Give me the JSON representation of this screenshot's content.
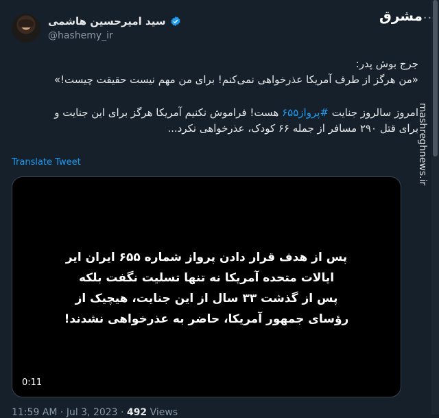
{
  "author": {
    "name": "سید امیرحسین هاشمی",
    "handle": "@hashemy_ir"
  },
  "tweet": {
    "line1": "جرج بوش پدر:",
    "line2": "«من هرگز از طرف آمریکا عذرخواهی نمی‌کنم! برای من مهم نیست حقیقت چیست!»",
    "line3_before": "امروز سالروز جنایت ",
    "hashtag": "#پرواز۶۵۵",
    "line3_after": " هست! فراموش نکنیم آمریکا هرگز برای این جنایت و",
    "line4": "برای قتل ۲۹۰ مسافر از جمله ۶۶ کودک، عذرخواهی نکرد..."
  },
  "translate_label": "Translate Tweet",
  "video": {
    "caption": [
      "پس از هدف قرار دادن پرواز شماره ۶۵۵ ایران ایر",
      "ایالات متحده آمریکا نه تنها تسلیت نگفت بلکه",
      "پس از گذشت ۳۳ سال از این جنایت، هیچیک از",
      "رؤسای جمهور آمریکا، حاضر به عذرخواهی نشدند!"
    ],
    "duration": "0:11"
  },
  "meta": {
    "time": "11:59 AM",
    "sep": "·",
    "date": "Jul 3, 2023",
    "views_count": "492",
    "views_label": "Views"
  },
  "watermark": {
    "logo": "مشرق",
    "side": "mashreghnews.ir"
  },
  "colors": {
    "background": "#15202b",
    "link": "#1d9bf0",
    "muted": "#8b98a5"
  }
}
